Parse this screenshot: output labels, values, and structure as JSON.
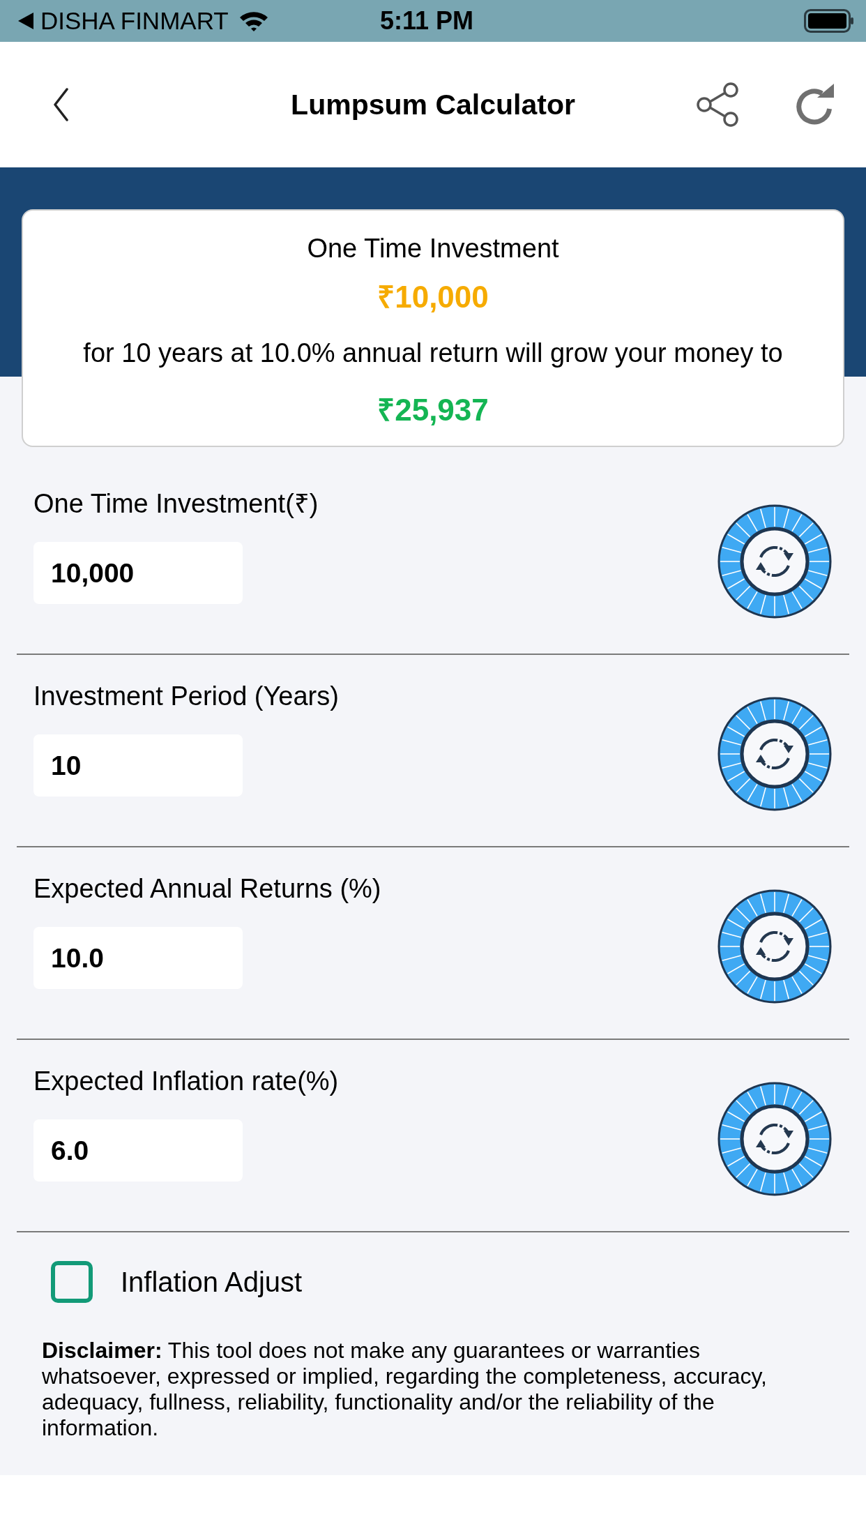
{
  "status_bar": {
    "carrier": "DISHA FINMART",
    "time": "5:11 PM"
  },
  "header": {
    "title": "Lumpsum Calculator"
  },
  "summary_card": {
    "heading": "One Time Investment",
    "amount": "₹10,000",
    "sentence": "for 10 years at 10.0% annual return will grow your money to",
    "result": "₹25,937"
  },
  "fields": [
    {
      "label": "One Time Investment(₹)",
      "value": "10,000"
    },
    {
      "label": "Investment Period (Years)",
      "value": "10"
    },
    {
      "label": "Expected Annual Returns (%)",
      "value": "10.0"
    },
    {
      "label": "Expected Inflation rate(%)",
      "value": "6.0"
    }
  ],
  "inflation_adjust": {
    "label": "Inflation Adjust",
    "checked": false
  },
  "disclaimer": "**Disclaimer:** This tool does not make any guarantees or warranties whatsoever, expressed or implied, regarding the completeness, accuracy, adequacy, fullness, reliability, functionality and/or the reliability of the information."
}
